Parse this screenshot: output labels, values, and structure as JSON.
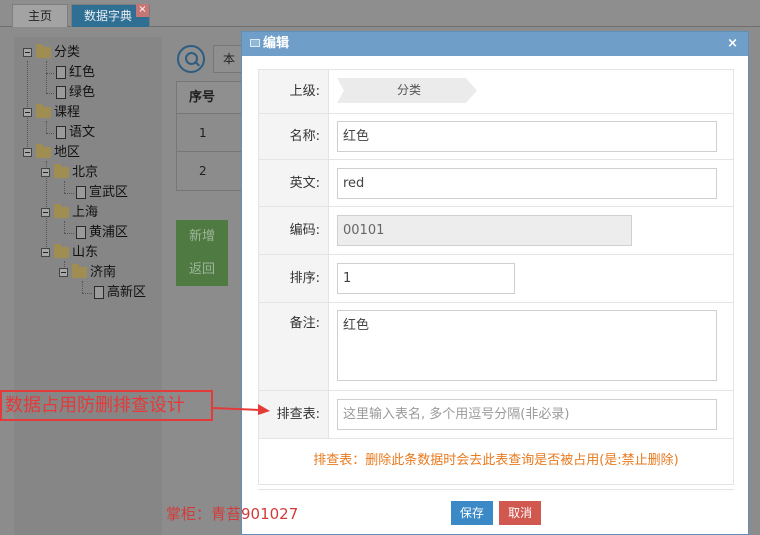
{
  "tabs": {
    "home": "主页",
    "dict": "数据字典",
    "close": "×"
  },
  "tree": {
    "n1": "分类",
    "n1a": "红色",
    "n1b": "绿色",
    "n2": "课程",
    "n2a": "语文",
    "n3": "地区",
    "n3a": "北京",
    "n3a1": "宣武区",
    "n3b": "上海",
    "n3b1": "黄浦区",
    "n3c": "山东",
    "n3c1": "济南",
    "n3c1a": "高新区"
  },
  "main": {
    "search_value": "本",
    "col_index": "序号",
    "row1": "1",
    "row2": "2",
    "btn_add": "新增",
    "btn_back": "返回"
  },
  "dialog": {
    "title": "编辑",
    "close": "×",
    "parent_label": "上级:",
    "parent_value": "分类",
    "name_label": "名称:",
    "name_value": "红色",
    "en_label": "英文:",
    "en_value": "red",
    "code_label": "编码:",
    "code_value": "00101",
    "order_label": "排序:",
    "order_value": "1",
    "remark_label": "备注:",
    "remark_value": "红色",
    "check_label": "排查表:",
    "check_placeholder": "这里输入表名, 多个用逗号分隔(非必录)",
    "note": "排查表：删除此条数据时会去此表查询是否被占用(是:禁止删除)",
    "save": "保存",
    "cancel": "取消"
  },
  "overlay": {
    "callout": "数据占用防删排查设计",
    "watermark": "掌柜：青苔901027"
  },
  "colors": {
    "accent": "#6f9fc8",
    "note": "#e87a1e",
    "callout": "#e43a3a"
  }
}
